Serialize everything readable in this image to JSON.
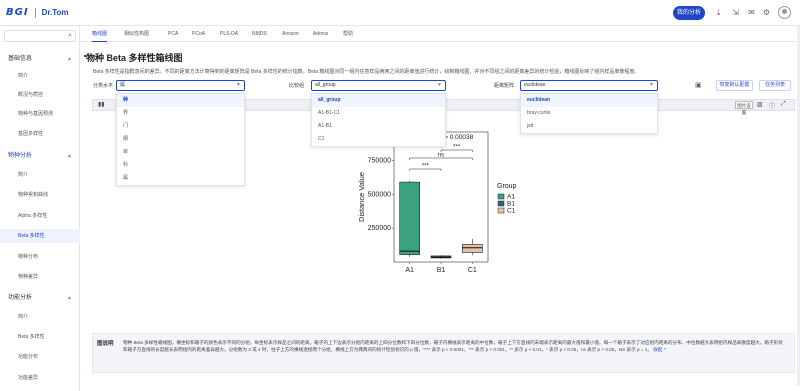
{
  "header": {
    "logo_main": "BGI",
    "logo_sub": "Dr.Tom",
    "my_analysis_button": "我的分析"
  },
  "sidebar": {
    "groups": [
      {
        "label": "基础信息",
        "items": [
          "简介",
          "概况与质控",
          "物种与基因预测",
          "基因多样性"
        ]
      },
      {
        "label": "物种分析",
        "items": [
          "简介",
          "物种累积曲线",
          "Alpha 多样性",
          "Beta 多样性",
          "物种分布",
          "物种差异"
        ]
      },
      {
        "label": "功能分析",
        "items": [
          "简介",
          "Beta 多样性",
          "功能分布",
          "功能差异"
        ]
      }
    ],
    "active_item": "Beta 多样性"
  },
  "tabs": [
    "箱线图",
    "相似性热图",
    "PCA",
    "PCoA",
    "PLS-DA",
    "NMDS",
    "Anosim",
    "Adonis",
    "帮助"
  ],
  "page": {
    "title": "物种 Beta 多样性箱线图",
    "description": "Beta 多样性是指群落间的差异。不同的距离方法计算得到的距离矩阵是 Beta 多样性的统计指数。Beta 箱线图对同一组内任意样品两两之间的距离值进行统计，绘制箱线图，并对不同组之间的距离差异的统计检验，箱线图反映了组内样品离散程度。"
  },
  "controls": {
    "level_label": "分类水平",
    "level_value": "属",
    "compare_label": "比较组",
    "compare_value": "all_group",
    "distance_label": "距离矩阵",
    "distance_value": "euclidean",
    "restore_button": "恢复默认配置",
    "task_list_button": "任务列表"
  },
  "toolbar": {
    "style_button": "图片设置"
  },
  "dropdowns": {
    "level_options": [
      "种",
      "界",
      "门",
      "纲",
      "目",
      "科",
      "属"
    ],
    "level_selected": "种",
    "compare_options": [
      "all_group",
      "A1-B1-C1",
      "A1-B1",
      "C1"
    ],
    "compare_selected": "all_group",
    "distance_options": [
      "euclidean",
      "bray-curtis",
      "jsd"
    ],
    "distance_selected": "euclidean"
  },
  "chart_data": {
    "type": "box",
    "ylabel": "Distance Value",
    "categories": [
      "A1",
      "B1",
      "C1"
    ],
    "yticks": [
      250000,
      500000,
      750000
    ],
    "ytick_labels": [
      "250000",
      "500000",
      "750000"
    ],
    "ylim": [
      0,
      960000
    ],
    "boxes": [
      {
        "name": "A1",
        "min": 40000,
        "q1": 55000,
        "median": 80000,
        "q3": 590000,
        "max": 600000,
        "color": "#3aa37e"
      },
      {
        "name": "B1",
        "min": 25000,
        "q1": 30000,
        "median": 35000,
        "q3": 45000,
        "max": 50000,
        "color": "#3f5a7a"
      },
      {
        "name": "C1",
        "min": 50000,
        "q1": 70000,
        "median": 105000,
        "q3": 130000,
        "max": 170000,
        "color": "#e1c3a8"
      }
    ],
    "significance": [
      {
        "pair": [
          "A1",
          "B1"
        ],
        "label": "***"
      },
      {
        "pair": [
          "A1",
          "C1"
        ],
        "label": "ns"
      },
      {
        "pair": [
          "B1",
          "C1"
        ],
        "label": "***"
      }
    ],
    "pvalue_label": "p = 0.00038",
    "legend_title": "Group",
    "legend": [
      "A1",
      "B1",
      "C1"
    ],
    "legend_position": "right"
  },
  "note": {
    "label": "图说明",
    "text": "物种 Beta 多样性箱线图。横坐标和箱子的颜色表示不同的分组，纵坐标表示样品之间的距离。箱子的上下边表示分组内距离的上四分位数和下四分位数，箱子内横线表示距离的中位数，箱子上下方直线的末端表示距离的最大值和最小值。每一个箱子表示了对应组内距离的分布，中位数越大表明组内样品离散度越大。箱子形状和箱子方直线的长度越长表明组内的距离差异越大。分组数为 3 或 4 时，柱子上方的横线连接两个分组，横线上方为两两间的统计检验标识的 p 值，**** 表示 p < 0.0001，*** 表示 p < 0.001，** 表示 p < 0.01，* 表示 p < 0.05，ns 表示 p > 0.05，NS 表示 p = 1。",
    "collapse_link": "收起"
  }
}
